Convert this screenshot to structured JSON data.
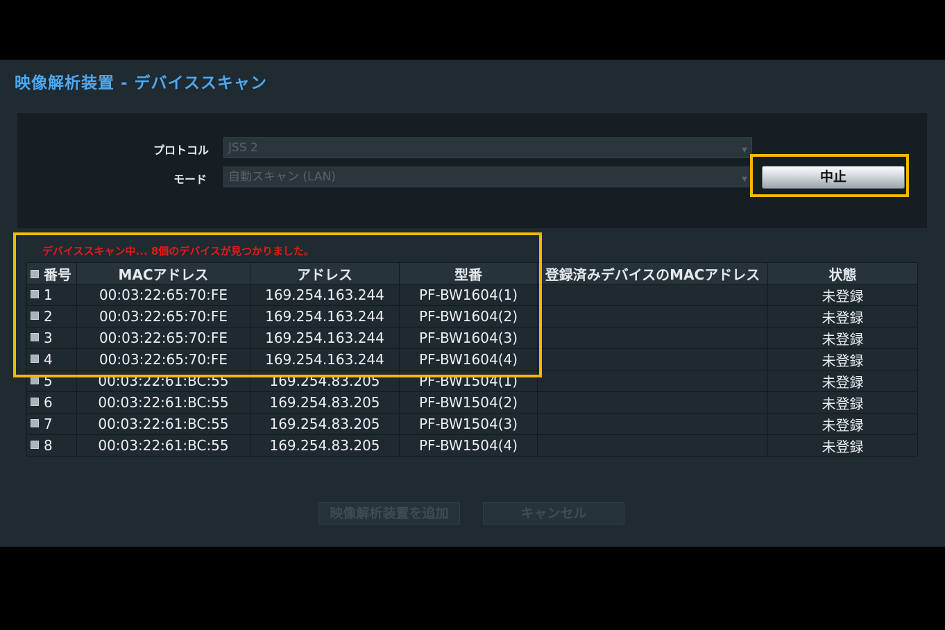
{
  "dialog": {
    "title": "映像解析装置 - デバイススキャン"
  },
  "form": {
    "protocol_label": "プロトコル",
    "protocol_value": "JSS 2",
    "mode_label": "モード",
    "mode_value": "自動スキャン (LAN)",
    "stop_label": "中止"
  },
  "scan_status": "デバイススキャン中... 8個のデバイスが見つかりました。",
  "table": {
    "headers": [
      "番号",
      "MACアドレス",
      "アドレス",
      "型番",
      "登録済みデバイスのMACアドレス",
      "状態"
    ],
    "rows": [
      {
        "num": "1",
        "mac": "00:03:22:65:70:FE",
        "address": "169.254.163.244",
        "model": "PF-BW1604(1)",
        "registered_mac": "",
        "status": "未登録"
      },
      {
        "num": "2",
        "mac": "00:03:22:65:70:FE",
        "address": "169.254.163.244",
        "model": "PF-BW1604(2)",
        "registered_mac": "",
        "status": "未登録"
      },
      {
        "num": "3",
        "mac": "00:03:22:65:70:FE",
        "address": "169.254.163.244",
        "model": "PF-BW1604(3)",
        "registered_mac": "",
        "status": "未登録"
      },
      {
        "num": "4",
        "mac": "00:03:22:65:70:FE",
        "address": "169.254.163.244",
        "model": "PF-BW1604(4)",
        "registered_mac": "",
        "status": "未登録"
      },
      {
        "num": "5",
        "mac": "00:03:22:61:BC:55",
        "address": "169.254.83.205",
        "model": "PF-BW1504(1)",
        "registered_mac": "",
        "status": "未登録"
      },
      {
        "num": "6",
        "mac": "00:03:22:61:BC:55",
        "address": "169.254.83.205",
        "model": "PF-BW1504(2)",
        "registered_mac": "",
        "status": "未登録"
      },
      {
        "num": "7",
        "mac": "00:03:22:61:BC:55",
        "address": "169.254.83.205",
        "model": "PF-BW1504(3)",
        "registered_mac": "",
        "status": "未登録"
      },
      {
        "num": "8",
        "mac": "00:03:22:61:BC:55",
        "address": "169.254.83.205",
        "model": "PF-BW1504(4)",
        "registered_mac": "",
        "status": "未登録"
      }
    ]
  },
  "footer": {
    "add_label": "映像解析装置を追加",
    "cancel_label": "キャンセル"
  },
  "colors": {
    "title": "#4ea8f0",
    "highlight": "#f5b800",
    "status_text": "#e21b1b"
  }
}
